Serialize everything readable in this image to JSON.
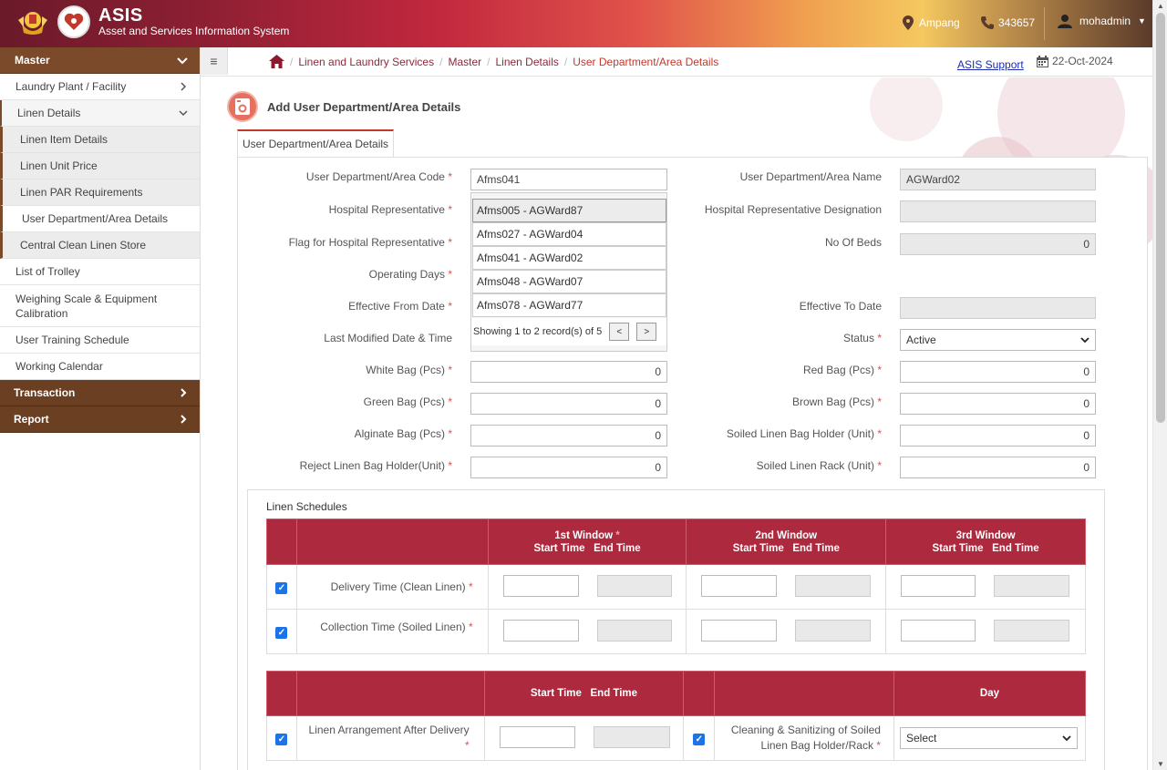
{
  "header": {
    "brand": "ASIS",
    "subtitle": "Asset and Services Information System",
    "location": "Ampang",
    "phone": "343657",
    "user": "mohadmin"
  },
  "sidebar": {
    "master": "Master",
    "items": [
      {
        "label": "Laundry Plant / Facility"
      },
      {
        "label": "Linen Details"
      },
      {
        "label": "Linen Item Details"
      },
      {
        "label": "Linen Unit Price"
      },
      {
        "label": "Linen PAR Requirements"
      },
      {
        "label": "User Department/Area Details"
      },
      {
        "label": "Central Clean Linen Store"
      },
      {
        "label": "List of Trolley"
      },
      {
        "label": "Weighing Scale & Equipment Calibration"
      },
      {
        "label": "User Training Schedule"
      },
      {
        "label": "Working Calendar"
      }
    ],
    "transaction": "Transaction",
    "report": "Report"
  },
  "topbar": {
    "menu_icon": "≡",
    "breadcrumb": [
      "Linen and Laundry Services",
      "Master",
      "Linen Details",
      "User Department/Area Details"
    ],
    "support": "ASIS Support",
    "date": "22-Oct-2024"
  },
  "page": {
    "title": "Add User Department/Area Details",
    "tab": "User Department/Area Details"
  },
  "form": {
    "code_label": "User Department/Area Code",
    "code_value": "Afms041",
    "name_label": "User Department/Area Name",
    "name_value": "AGWard02",
    "hosp_rep_label": "Hospital Representative",
    "hosp_rep_desig_label": "Hospital Representative Designation",
    "flag_label": "Flag for Hospital Representative",
    "beds_label": "No Of Beds",
    "beds_value": "0",
    "op_days_label": "Operating Days",
    "eff_from_label": "Effective From Date",
    "eff_to_label": "Effective To Date",
    "last_mod_label": "Last Modified Date & Time",
    "status_label": "Status",
    "status_value": "Active",
    "white_bag_label": "White Bag (Pcs)",
    "white_bag_value": "0",
    "red_bag_label": "Red Bag (Pcs)",
    "red_bag_value": "0",
    "green_bag_label": "Green Bag (Pcs)",
    "green_bag_value": "0",
    "brown_bag_label": "Brown Bag (Pcs)",
    "brown_bag_value": "0",
    "alginate_label": "Alginate Bag (Pcs)",
    "alginate_value": "0",
    "soiled_holder_label": "Soiled Linen Bag Holder (Unit)",
    "soiled_holder_value": "0",
    "reject_holder_label": "Reject Linen Bag Holder(Unit)",
    "reject_holder_value": "0",
    "soiled_rack_label": "Soiled Linen Rack (Unit)",
    "soiled_rack_value": "0",
    "required_mark": "*"
  },
  "dropdown": {
    "items": [
      "Afms005 - AGWard87",
      "Afms027 - AGWard04",
      "Afms041 - AGWard02",
      "Afms048 - AGWard07",
      "Afms078 - AGWard77"
    ],
    "footer": "Showing 1 to 2 record(s) of 5",
    "prev": "<",
    "next": ">"
  },
  "schedules": {
    "title": "Linen Schedules",
    "win1": "1st Window",
    "win2": "2nd Window",
    "win3": "3rd Window",
    "start": "Start Time",
    "end": "End Time",
    "delivery": "Delivery Time (Clean Linen)",
    "collection": "Collection Time (Soiled Linen)",
    "day": "Day",
    "arrangement": "Linen Arrangement After Delivery",
    "cleaning": "Cleaning & Sanitizing of Soiled Linen Bag Holder/Rack",
    "select": "Select"
  }
}
